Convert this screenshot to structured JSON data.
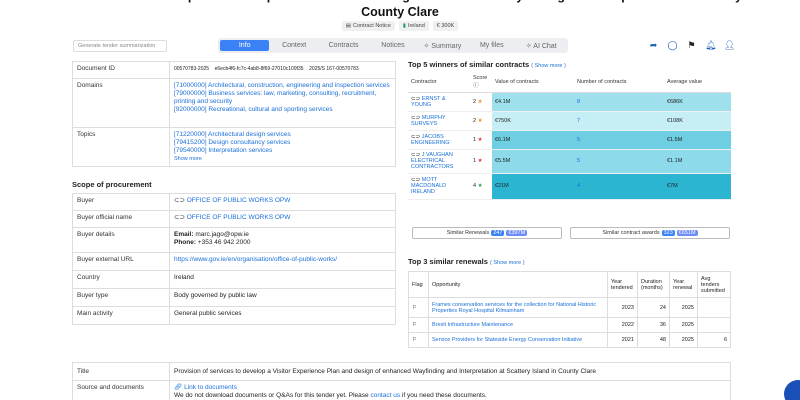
{
  "header": {
    "title": "Provision of services to develop a Visitor Experience Plan and design of enhanced Wayfinding and Interpretation at Scattery Island in County Clare",
    "chips": [
      "Contract Notice",
      "Ireland",
      "€ 300K"
    ]
  },
  "summary_button": "Generate tender summarization",
  "tabs": [
    "Info",
    "Context",
    "Contracts",
    "Notices",
    "Summary",
    "My files",
    "AI Chat"
  ],
  "info": {
    "doc_id_label": "Document ID",
    "doc_id_values": [
      "00570783-2025",
      "e6ecb4f6-fc7c-4ab8-8f69-27010c109f35",
      "2025/S 167-00570783"
    ],
    "domains_label": "Domains",
    "domains": [
      "[71000000] Architectural, construction, engineering and inspection services",
      "[79000000] Business services: law, marketing, consulting, recruitment, printing and security",
      "[92000000] Recreational, cultural and sporting services"
    ],
    "topics_label": "Topics",
    "topics": [
      "[71220000] Architectural design services",
      "[79415200] Design consultancy services",
      "[79540000] Interpretation services"
    ],
    "show_more": "Show more"
  },
  "scope": {
    "heading": "Scope of procurement",
    "buyer_label": "Buyer",
    "buyer": "OFFICE OF PUBLIC WORKS OPW",
    "buyer_official_label": "Buyer official name",
    "buyer_official": "OFFICE OF PUBLIC WORKS OPW",
    "buyer_details_label": "Buyer details",
    "email_label": "Email:",
    "email": "marc.jago@opw.ie",
    "phone_label": "Phone:",
    "phone": "+353 46 942 2000",
    "url_label": "Buyer external URL",
    "url": "https://www.gov.ie/en/organisation/office-of-public-works/",
    "country_label": "Country",
    "country": "Ireland",
    "buyer_type_label": "Buyer type",
    "buyer_type": "Body governed by public law",
    "activity_label": "Main activity",
    "activity": "General public services"
  },
  "winners": {
    "heading": "Top 5 winners of similar contracts",
    "show_more": "( Show more )",
    "headers": [
      "Contractor",
      "Score",
      "Value of contracts",
      "Number of contracts",
      "Average value"
    ],
    "rows": [
      {
        "name": "ERNST & YOUNG",
        "score": "2",
        "value": "€4.1M",
        "count": "8",
        "avg": "€686K"
      },
      {
        "name": "MURPHY SURVEYS",
        "score": "2",
        "value": "€750K",
        "count": "7",
        "avg": "€108K"
      },
      {
        "name": "JACOBS ENGINEERING",
        "score": "1",
        "value": "€6.1M",
        "count": "5",
        "avg": "€1.5M"
      },
      {
        "name": "J VAUGHAN ELECTRICAL CONTRACTORS",
        "score": "1",
        "value": "€5.5M",
        "count": "5",
        "avg": "€1.1M"
      },
      {
        "name": "MOTT MACDONALD IRELAND",
        "score": "4",
        "value": "€21M",
        "count": "4",
        "avg": "€7M"
      }
    ],
    "similar_renewals_label": "Similar Renewals",
    "similar_renewals_count": "247",
    "similar_renewals_value": "€397M",
    "similar_awards_label": "Similar contract awards",
    "similar_awards_count": "323",
    "similar_awards_value": "€651M"
  },
  "renewals": {
    "heading": "Top 3 similar renewals",
    "show_more": "( Show more )",
    "headers": [
      "Flag",
      "Opportunity",
      "Year tendered",
      "Duration (months)",
      "Year renewal",
      "Avg tenders submitted"
    ],
    "rows": [
      {
        "opp": "Frames conservation services for the collection for National Historic Properties Royal Hospital Kilmainham",
        "year": "2023",
        "duration": "24",
        "renewal": "2025",
        "avg": ""
      },
      {
        "opp": "Brexit Infrastructure Maintenance",
        "year": "2022",
        "duration": "36",
        "renewal": "2025",
        "avg": ""
      },
      {
        "opp": "Service Providers for Stateside Energy Conservation Initiative",
        "year": "2021",
        "duration": "48",
        "renewal": "2025",
        "avg": "6"
      }
    ]
  },
  "bottom": {
    "title_label": "Title",
    "title_value": "Provision of services to develop a Visitor Experience Plan and design of enhanced Wayfinding and Interpretation at Scattery Island in County Clare",
    "source_label": "Source and documents",
    "link_label": "Link to documents",
    "note_prefix": "We do not download documents or Q&As for this tender yet. Please",
    "note_link": "contact us",
    "note_suffix": "if you need these documents."
  },
  "colors": {
    "accent": "#3b82f6",
    "link": "#1a6fd8",
    "cyan_light": "#c6eef5",
    "cyan_mid": "#9ee0ec",
    "cyan_dark": "#2bb5d1"
  }
}
